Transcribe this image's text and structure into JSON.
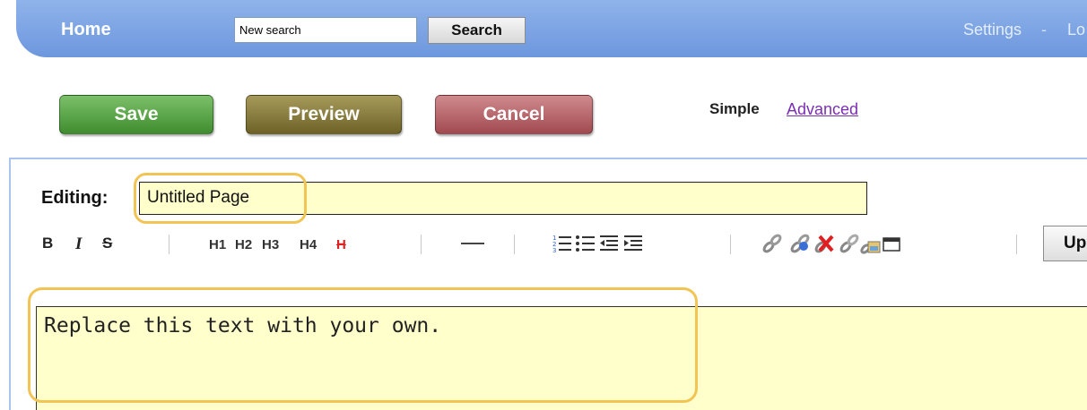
{
  "nav": {
    "home": "Home",
    "search_value": "New search",
    "search_button": "Search",
    "settings": "Settings",
    "separator": "-",
    "logout_partial": "Lo"
  },
  "actions": {
    "save": "Save",
    "preview": "Preview",
    "cancel": "Cancel"
  },
  "mode": {
    "simple": "Simple",
    "advanced": "Advanced"
  },
  "editor": {
    "editing_label": "Editing:",
    "title_value": "Untitled Page",
    "body_text": "Replace this text with your own."
  },
  "toolbar": {
    "bold": "B",
    "italic": "I",
    "strike": "S",
    "h1": "H1",
    "h2": "H2",
    "h3": "H3",
    "h4": "H4",
    "remove_heading": "H",
    "upload_partial": "Up",
    "icons": [
      "bold-icon",
      "italic-icon",
      "strikethrough-icon",
      "h1-icon",
      "h2-icon",
      "h3-icon",
      "h4-icon",
      "remove-heading-icon",
      "horizontal-rule-icon",
      "numbered-list-icon",
      "bullet-list-icon",
      "outdent-icon",
      "indent-icon",
      "link-icon",
      "link-anchor-icon",
      "unlink-icon",
      "link-edit-icon",
      "image-icon",
      "table-icon",
      "upload-button"
    ]
  },
  "colors": {
    "nav_bar": "#7aa1e2",
    "save": "#4b9a38",
    "preview": "#7d7033",
    "cancel": "#b45a60",
    "field_bg": "#ffffcc",
    "highlight": "#f1c453",
    "link": "#7a2fb0"
  }
}
